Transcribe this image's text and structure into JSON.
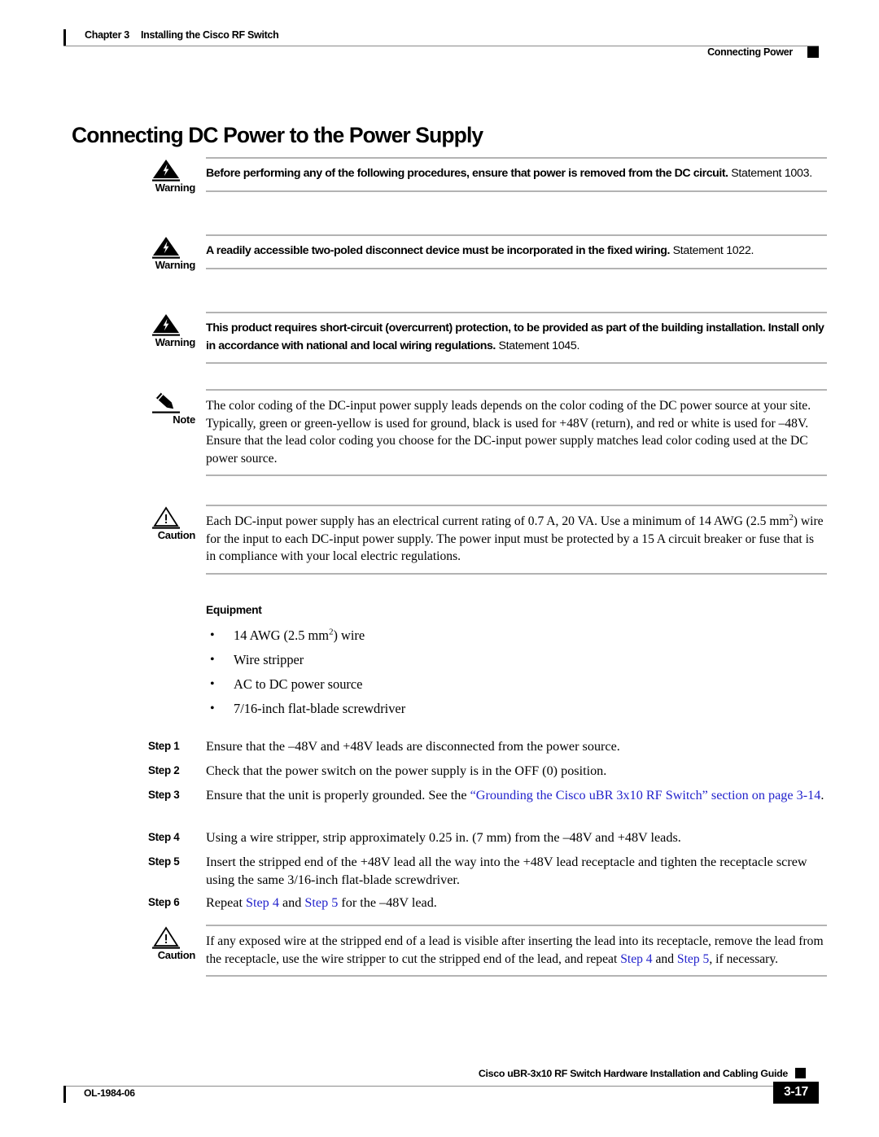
{
  "header": {
    "chapter": "Chapter 3",
    "chapter_title": "Installing the Cisco RF Switch",
    "section": "Connecting Power"
  },
  "page_title": "Connecting DC Power to the Power Supply",
  "admonitions": [
    {
      "icon": "warning-triangle-lightning-icon",
      "label": "Warning",
      "bold": "Before performing any of the following procedures, ensure that power is removed from the DC circuit.",
      "plain": "Statement 1003."
    },
    {
      "icon": "warning-triangle-lightning-icon",
      "label": "Warning",
      "bold": "A readily accessible two-poled disconnect device must be incorporated in the fixed wiring.",
      "plain": "Statement 1022."
    },
    {
      "icon": "warning-triangle-lightning-icon",
      "label": "Warning",
      "bold": "This product requires short-circuit (overcurrent) protection, to be provided as part of the building installation. Install only in accordance with national and local wiring regulations.",
      "plain": "Statement 1045."
    }
  ],
  "note": {
    "icon": "note-pencil-icon",
    "label": "Note",
    "text": "The color coding of the DC-input power supply leads depends on the color coding of the DC power source at your site. Typically, green or green-yellow is used for ground, black is used for +48V (return), and red or white is used for –48V. Ensure that the lead color coding you choose for the DC-input power supply matches lead color coding used at the DC power source."
  },
  "caution_1": {
    "icon": "caution-triangle-exclamation-icon",
    "label": "Caution",
    "text_part1": "Each DC-input power supply has an electrical current rating of 0.7 A, 20 VA. Use a minimum of 14 AWG (2.5 mm",
    "text_sup": "2",
    "text_part2": ") wire for the input to each DC-input power supply. The power input must be protected by a 15 A circuit breaker or fuse that is in compliance with your local electric regulations."
  },
  "equipment": {
    "heading": "Equipment",
    "items": [
      {
        "pre": "14 AWG (2.5 mm",
        "sup": "2",
        "post": ") wire"
      },
      {
        "pre": "Wire stripper",
        "sup": "",
        "post": ""
      },
      {
        "pre": "AC to DC power source",
        "sup": "",
        "post": ""
      },
      {
        "pre": "7/16-inch flat-blade screwdriver",
        "sup": "",
        "post": ""
      }
    ],
    "bullet": "•"
  },
  "steps": [
    {
      "label": "Step 1",
      "segments": [
        {
          "text": "Ensure that the –48V and +48V leads are disconnected from the power source.",
          "link": false
        }
      ]
    },
    {
      "label": "Step 2",
      "segments": [
        {
          "text": "Check that the power switch on the power supply is in the OFF (0) position.",
          "link": false
        }
      ]
    },
    {
      "label": "Step 3",
      "segments": [
        {
          "text": "Ensure that the unit is properly grounded. See the ",
          "link": false
        },
        {
          "text": "“Grounding the Cisco uBR 3x10 RF Switch” section on page 3-14",
          "link": true
        },
        {
          "text": ".",
          "link": false
        }
      ]
    },
    {
      "label": "Step 4",
      "segments": [
        {
          "text": "Using a wire stripper, strip approximately 0.25 in. (7 mm) from the –48V and +48V leads.",
          "link": false
        }
      ]
    },
    {
      "label": "Step 5",
      "segments": [
        {
          "text": "Insert the stripped end of the +48V lead all the way into the +48V lead receptacle and tighten the receptacle screw using the same 3/16-inch flat-blade screwdriver.",
          "link": false
        }
      ]
    },
    {
      "label": "Step 6",
      "segments": [
        {
          "text": "Repeat ",
          "link": false
        },
        {
          "text": "Step 4",
          "link": true
        },
        {
          "text": " and ",
          "link": false
        },
        {
          "text": "Step 5",
          "link": true
        },
        {
          "text": " for the –48V lead.",
          "link": false
        }
      ]
    }
  ],
  "caution_2": {
    "icon": "caution-triangle-exclamation-icon",
    "label": "Caution",
    "segments": [
      {
        "text": "If any exposed wire at the stripped end of a lead is visible after inserting the lead into its receptacle, remove the lead from the receptacle, use the wire stripper to cut the stripped end of the lead, and repeat ",
        "link": false
      },
      {
        "text": "Step 4",
        "link": true
      },
      {
        "text": " and ",
        "link": false
      },
      {
        "text": "Step 5",
        "link": true
      },
      {
        "text": ", if necessary.",
        "link": false
      }
    ]
  },
  "footer": {
    "doc_id": "OL-1984-06",
    "guide_title": "Cisco uBR-3x10 RF Switch Hardware Installation and Cabling Guide",
    "page_number": "3-17"
  },
  "colors": {
    "link": "#2222cc",
    "rule": "#b3b3b3",
    "header_rule": "#8a8a8a"
  }
}
